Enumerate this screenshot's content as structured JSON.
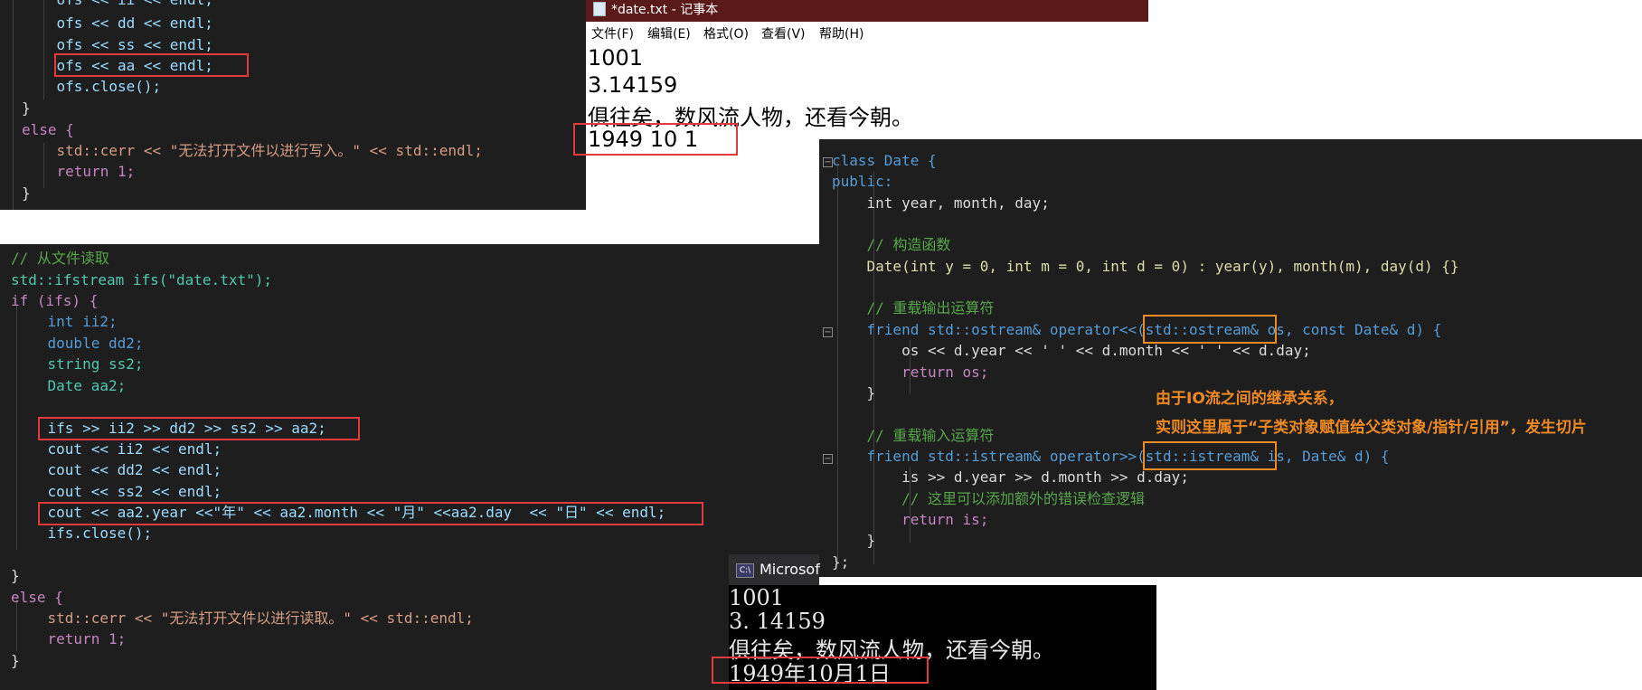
{
  "panel1": {
    "lines": [
      "    ofs << ii << endl;",
      "    ofs << dd << endl;",
      "    ofs << ss << endl;",
      "    ofs << aa << endl;",
      "    ofs.close();",
      "}",
      "else {",
      "    std::cerr << \"无法打开文件以进行写入。\" << std::endl;",
      "    return 1;",
      "}"
    ]
  },
  "notepad": {
    "title": "*date.txt - 记事本",
    "menu": [
      "文件(F)",
      "编辑(E)",
      "格式(O)",
      "查看(V)",
      "帮助(H)"
    ],
    "lines": [
      "1001",
      "3.14159",
      "俱往矣，数风流人物，还看今朝。",
      "1949 10 1"
    ]
  },
  "panel2": {
    "lines": [
      "// 从文件读取",
      "std::ifstream ifs(\"date.txt\");",
      "if (ifs) {",
      "    int ii2;",
      "    double dd2;",
      "    string ss2;",
      "    Date aa2;",
      "",
      "    ifs >> ii2 >> dd2 >> ss2 >> aa2;",
      "    cout << ii2 << endl;",
      "    cout << dd2 << endl;",
      "    cout << ss2 << endl;",
      "    cout << aa2.year <<\"年\" << aa2.month << \"月\" <<aa2.day  << \"日\" << endl;",
      "    ifs.close();",
      "",
      "}",
      "else {",
      "    std::cerr << \"无法打开文件以进行读取。\" << std::endl;",
      "    return 1;",
      "}"
    ]
  },
  "panel3": {
    "lines": [
      "class Date {",
      "public:",
      "    int year, month, day;",
      "",
      "    // 构造函数",
      "    Date(int y = 0, int m = 0, int d = 0) : year(y), month(m), day(d) {}",
      "",
      "    // 重载输出运算符",
      "    friend std::ostream& operator<<(std::ostream& os, const Date& d) {",
      "        os << d.year << ' ' << d.month << ' ' << d.day;",
      "        return os;",
      "    }",
      "",
      "    // 重载输入运算符",
      "    friend std::istream& operator>>(std::istream& is, Date& d) {",
      "        is >> d.year >> d.month >> d.day;",
      "        // 这里可以添加额外的错误检查逻辑",
      "        return is;",
      "    }",
      "};"
    ]
  },
  "annotation": {
    "line1": "由于IO流之间的继承关系，",
    "line2": "实则这里属于“子类对象赋值给父类对象/指针/引用”，发生切片"
  },
  "console": {
    "title": "Microsof",
    "lines": [
      "1001",
      "3. 14159",
      "俱往矣，数风流人物，还看今朝。",
      "1949年10月1日"
    ]
  },
  "colors": {
    "editor_bg": "#1e1e1e",
    "highlight_red": "#e23b3b",
    "highlight_orange": "#f08a24",
    "notepad_title_bg": "#5b1a1a"
  }
}
